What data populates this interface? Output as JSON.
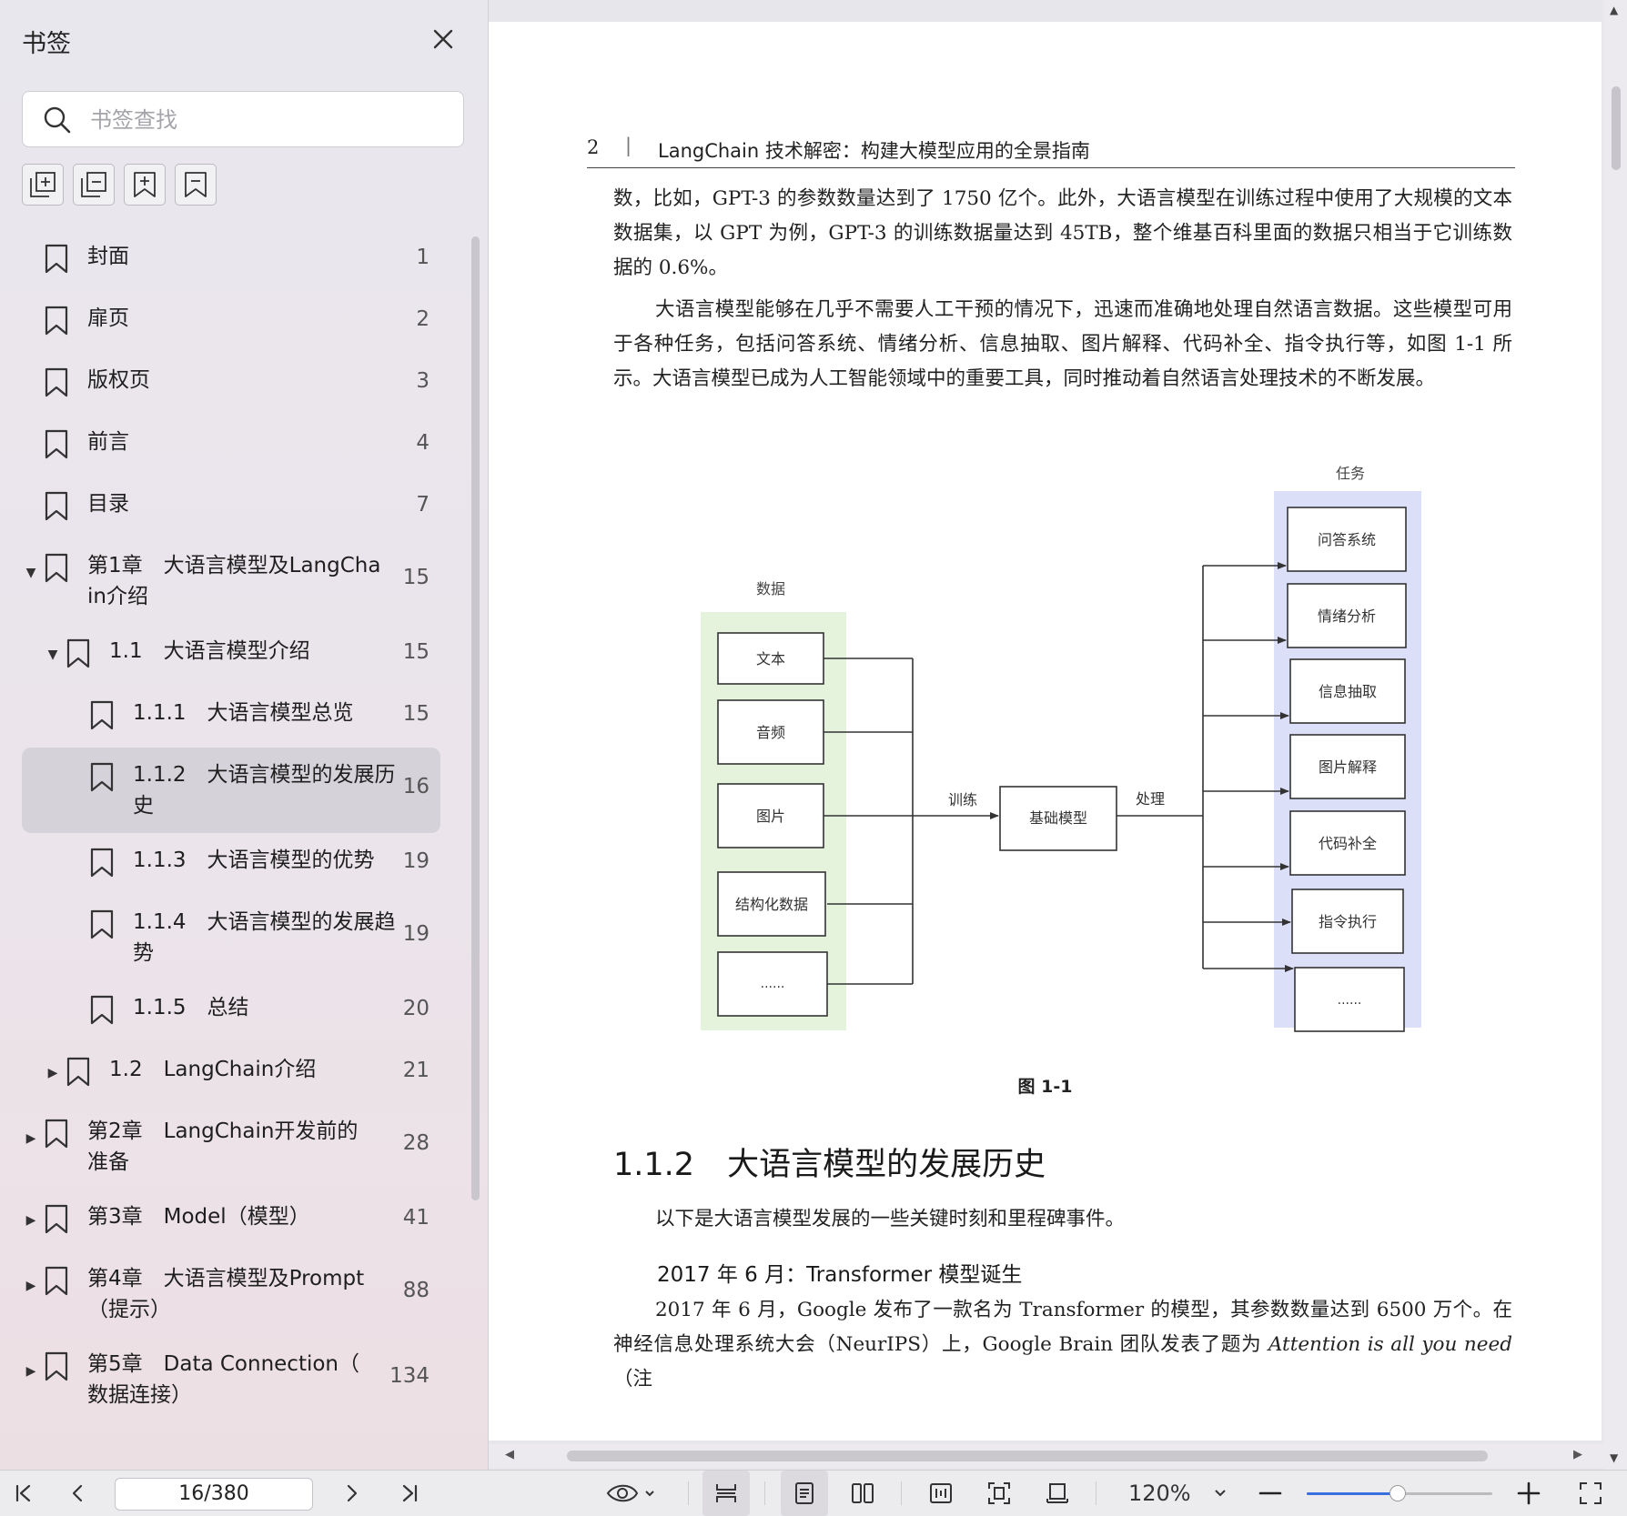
{
  "sidebar": {
    "title": "书签",
    "search_placeholder": "书签查找",
    "tools": [
      "expand-all-icon",
      "collapse-all-icon",
      "add-bookmark-icon",
      "bookmark-page-icon"
    ],
    "items": [
      {
        "label": "封面",
        "page": "1",
        "level": 0,
        "toggle": "none",
        "lines": 1
      },
      {
        "label": "扉页",
        "page": "2",
        "level": 0,
        "toggle": "none",
        "lines": 1
      },
      {
        "label": "版权页",
        "page": "3",
        "level": 0,
        "toggle": "none",
        "lines": 1
      },
      {
        "label": "前言",
        "page": "4",
        "level": 0,
        "toggle": "none",
        "lines": 1
      },
      {
        "label": "目录",
        "page": "7",
        "level": 0,
        "toggle": "none",
        "lines": 1
      },
      {
        "label": "第1章　大语言模型及LangCha\nin介绍",
        "page": "15",
        "level": 0,
        "toggle": "expanded",
        "lines": 2
      },
      {
        "label": "1.1　大语言模型介绍",
        "page": "15",
        "level": 1,
        "toggle": "expanded",
        "lines": 1
      },
      {
        "label": "1.1.1　大语言模型总览",
        "page": "15",
        "level": 2,
        "toggle": "none",
        "lines": 1
      },
      {
        "label": "1.1.2　大语言模型的发展历\n史",
        "page": "16",
        "level": 2,
        "toggle": "none",
        "lines": 2,
        "active": true
      },
      {
        "label": "1.1.3　大语言模型的优势",
        "page": "19",
        "level": 2,
        "toggle": "none",
        "lines": 1
      },
      {
        "label": "1.1.4　大语言模型的发展趋\n势",
        "page": "19",
        "level": 2,
        "toggle": "none",
        "lines": 2
      },
      {
        "label": "1.1.5　总结",
        "page": "20",
        "level": 2,
        "toggle": "none",
        "lines": 1
      },
      {
        "label": "1.2　LangChain介绍",
        "page": "21",
        "level": 1,
        "toggle": "collapsed",
        "lines": 1
      },
      {
        "label": "第2章　LangChain开发前的\n准备",
        "page": "28",
        "level": 0,
        "toggle": "collapsed",
        "lines": 2
      },
      {
        "label": "第3章　Model（模型）",
        "page": "41",
        "level": 0,
        "toggle": "collapsed",
        "lines": 1
      },
      {
        "label": "第4章　大语言模型及Prompt\n（提示）",
        "page": "88",
        "level": 0,
        "toggle": "collapsed",
        "lines": 2
      },
      {
        "label": "第5章　Data Connection（\n数据连接）",
        "page": "134",
        "level": 0,
        "toggle": "collapsed",
        "lines": 2
      }
    ]
  },
  "document": {
    "header_page_number": "2",
    "header_separator": "|",
    "header_title": "LangChain 技术解密：构建大模型应用的全景指南",
    "paragraph1": "数，比如，GPT-3 的参数数量达到了 1750 亿个。此外，大语言模型在训练过程中使用了大规模的文本数据集，以 GPT 为例，GPT-3 的训练数据量达到 45TB，整个维基百科里面的数据只相当于它训练数据的 0.6%。",
    "paragraph2": "大语言模型能够在几乎不需要人工干预的情况下，迅速而准确地处理自然语言数据。这些模型可用于各种任务，包括问答系统、情绪分析、信息抽取、图片解释、代码补全、指令执行等，如图 1-1 所示。大语言模型已成为人工智能领域中的重要工具，同时推动着自然语言处理技术的不断发展。",
    "figure": {
      "data_title": "数据",
      "data_items": [
        "文本",
        "音频",
        "图片",
        "结构化数据",
        "......"
      ],
      "train_label": "训练",
      "model_label": "基础模型",
      "process_label": "处理",
      "task_title": "任务",
      "task_items": [
        "问答系统",
        "情绪分析",
        "信息抽取",
        "图片解释",
        "代码补全",
        "指令执行",
        "......"
      ],
      "caption": "图 1-1",
      "data_color": "#e6f3dc",
      "task_color": "#dcdff8"
    },
    "section_number": "1.1.2",
    "section_title": "大语言模型的发展历史",
    "paragraph3": "以下是大语言模型发展的一些关键时刻和里程碑事件。",
    "subheading": "2017 年 6 月：Transformer 模型诞生",
    "paragraph4_main": "2017 年 6 月，Google 发布了一款名为 Transformer 的模型，其参数数量达到 6500 万个。在神经信息处理系统大会（NeurIPS）上，Google Brain 团队发表了题为",
    "paragraph4_italic": "Attention is all you need",
    "paragraph4_tail": "（注"
  },
  "toolbar": {
    "page_indicator": "16/380",
    "zoom": "120%",
    "zoom_slider_fraction": 0.49,
    "accent_color": "#3a6fe0"
  }
}
